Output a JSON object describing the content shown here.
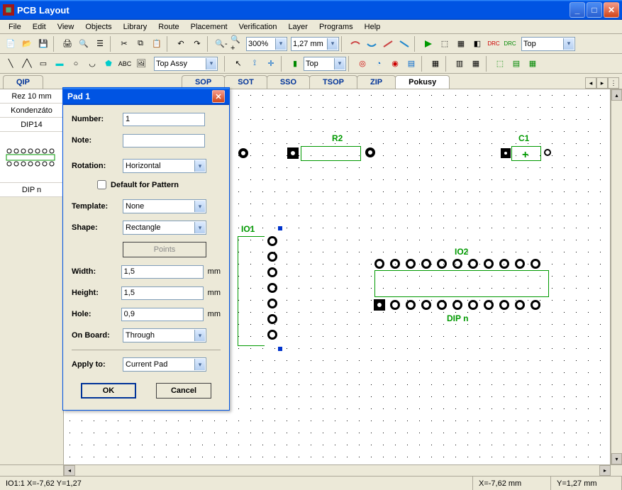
{
  "window": {
    "title": "PCB Layout"
  },
  "menu": [
    "File",
    "Edit",
    "View",
    "Objects",
    "Library",
    "Route",
    "Placement",
    "Verification",
    "Layer",
    "Programs",
    "Help"
  ],
  "toolbar1": {
    "zoom": "300%",
    "grid": "1,27 mm",
    "layer": "Top"
  },
  "toolbar2": {
    "layer_combo": "Top Assy",
    "side_combo": "Top"
  },
  "tabs": [
    "QIP",
    "SOP",
    "SOT",
    "SSO",
    "TSOP",
    "ZIP",
    "Pokusy"
  ],
  "side": {
    "items": [
      "Rez 10 mm",
      "Kondenzáto",
      "DIP14",
      "DIP n"
    ]
  },
  "canvas": {
    "r2": "R2",
    "c1": "C1",
    "io1": "IO1",
    "io2": "IO2",
    "dipn": "DIP n"
  },
  "dialog": {
    "title": "Pad 1",
    "labels": {
      "number": "Number:",
      "note": "Note:",
      "rotation": "Rotation:",
      "default": "Default for Pattern",
      "template": "Template:",
      "shape": "Shape:",
      "points": "Points",
      "width": "Width:",
      "height": "Height:",
      "hole": "Hole:",
      "onboard": "On Board:",
      "applyto": "Apply to:",
      "ok": "OK",
      "cancel": "Cancel",
      "mm": "mm"
    },
    "values": {
      "number": "1",
      "note": "",
      "rotation": "Horizontal",
      "template": "None",
      "shape": "Rectangle",
      "width": "1,5",
      "height": "1,5",
      "hole": "0,9",
      "onboard": "Through",
      "applyto": "Current Pad"
    }
  },
  "status": {
    "left": "IO1:1   X=-7,62  Y=1,27",
    "x": "X=-7,62 mm",
    "y": "Y=1,27 mm"
  }
}
